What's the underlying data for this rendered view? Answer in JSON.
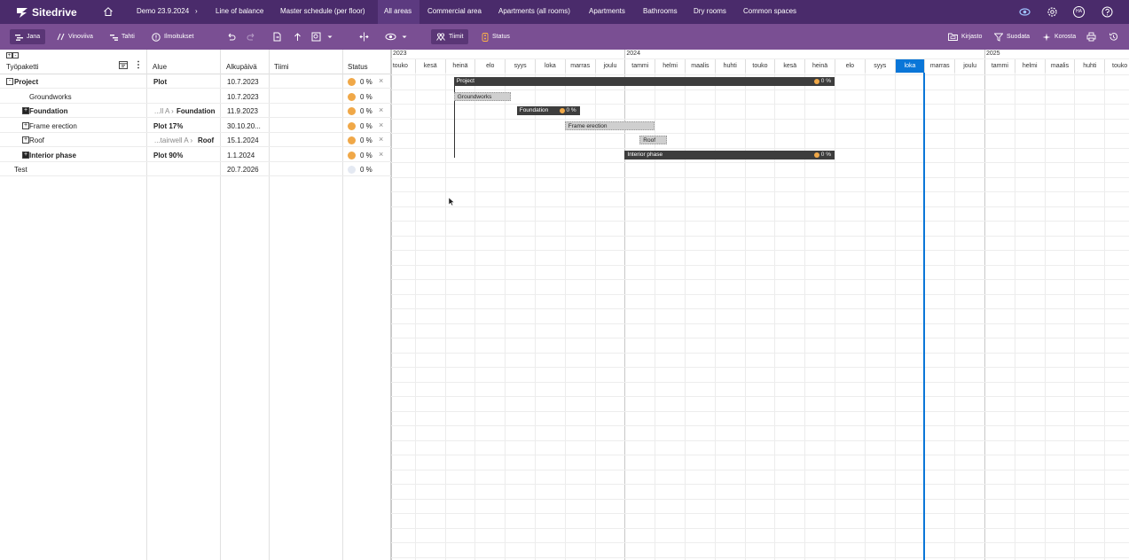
{
  "app": {
    "name": "Sitedrive"
  },
  "nav": {
    "items": [
      "Demo 23.9.2024",
      "Line of balance",
      "Master schedule (per floor)",
      "All areas",
      "Commercial area",
      "Apartments (all rooms)",
      "Apartments",
      "Bathrooms",
      "Dry rooms",
      "Common spaces"
    ],
    "chevron": "›",
    "active": "All areas",
    "user_initials": "HA"
  },
  "toolbar": {
    "jana": "Jana",
    "vinoviiva": "Vinoviiva",
    "tahti": "Tahti",
    "ilmoitukset": "Ilmoitukset",
    "tiimit": "Tiimit",
    "status": "Status",
    "kirjasto": "Kirjasto",
    "suodata": "Suodata",
    "korosta": "Korosta"
  },
  "table": {
    "headers": {
      "workpackage": "Työpaketti",
      "area": "Alue",
      "start": "Alkupäivä",
      "team": "Tiimi",
      "status": "Status"
    },
    "rows": [
      {
        "name": "Project",
        "area": "Plot",
        "area_prefix": "",
        "start": "10.7.2023",
        "status": "0 %",
        "bold": true,
        "dot": "#f0a848",
        "x": true,
        "expander": "minus",
        "indent": 0
      },
      {
        "name": "Groundworks",
        "area": "",
        "area_prefix": "",
        "start": "10.7.2023",
        "status": "0 %",
        "bold": false,
        "dot": "#f0a848",
        "x": false,
        "expander": "",
        "indent": 2
      },
      {
        "name": "Foundation",
        "area": "Foundation",
        "area_prefix": "...ll A ›",
        "start": "11.9.2023",
        "status": "0 %",
        "bold": true,
        "dot": "#f0a848",
        "x": true,
        "expander": "plus-filled",
        "indent": 1
      },
      {
        "name": "Frame erection",
        "area": "Plot 17%",
        "area_prefix": "",
        "start": "30.10.20...",
        "status": "0 %",
        "bold": false,
        "dot": "#f0a848",
        "x": true,
        "expander": "plus",
        "indent": 1
      },
      {
        "name": "Roof",
        "area": "Roof",
        "area_prefix": "...tairwell A ›",
        "start": "15.1.2024",
        "status": "0 %",
        "bold": false,
        "dot": "#f0a848",
        "x": true,
        "expander": "plus",
        "indent": 1
      },
      {
        "name": "Interior phase",
        "area": "Plot 90%",
        "area_prefix": "",
        "start": "1.1.2024",
        "status": "0 %",
        "bold": true,
        "dot": "#f0a848",
        "x": true,
        "expander": "plus-filled",
        "indent": 1
      },
      {
        "name": "Test",
        "area": "",
        "area_prefix": "",
        "start": "20.7.2026",
        "status": "0 %",
        "bold": false,
        "dot": "#e4e9f2",
        "x": false,
        "expander": "",
        "indent": 0
      }
    ]
  },
  "gantt": {
    "years": [
      {
        "label": "2023",
        "month_index": 0
      },
      {
        "label": "2024",
        "month_index": 8
      },
      {
        "label": "2025",
        "month_index": 20
      }
    ],
    "months": [
      "touko",
      "kesä",
      "heinä",
      "elo",
      "syys",
      "loka",
      "marras",
      "joulu",
      "tammi",
      "helmi",
      "maalis",
      "huhti",
      "touko",
      "kesä",
      "heinä",
      "elo",
      "syys",
      "loka",
      "marras",
      "joulu",
      "tammi",
      "helmi",
      "maalis",
      "huhti",
      "touko"
    ],
    "current_month_index": 17,
    "bars": [
      {
        "label": "Project",
        "row": 0,
        "start_month": 2.3,
        "end_month": 15.0,
        "style": "dark",
        "pct": "0 %"
      },
      {
        "label": "Groundworks",
        "row": 1,
        "start_month": 2.3,
        "end_month": 4.2,
        "style": "light",
        "pct": ""
      },
      {
        "label": "Foundation",
        "row": 2,
        "start_month": 4.4,
        "end_month": 6.5,
        "style": "dark",
        "pct": "0 %"
      },
      {
        "label": "Frame erection",
        "row": 3,
        "start_month": 6.0,
        "end_month": 9.0,
        "style": "light",
        "pct": ""
      },
      {
        "label": "Roof",
        "row": 4,
        "start_month": 8.5,
        "end_month": 9.4,
        "style": "light",
        "pct": ""
      },
      {
        "label": "Interior phase",
        "row": 5,
        "start_month": 8.0,
        "end_month": 15.0,
        "style": "dark",
        "pct": "0 %"
      }
    ]
  },
  "colors": {
    "nav_bg": "#4a2b6b",
    "toolbar_bg": "#7a4f93",
    "status_dot": "#f0a848",
    "today": "#0a76d8"
  }
}
